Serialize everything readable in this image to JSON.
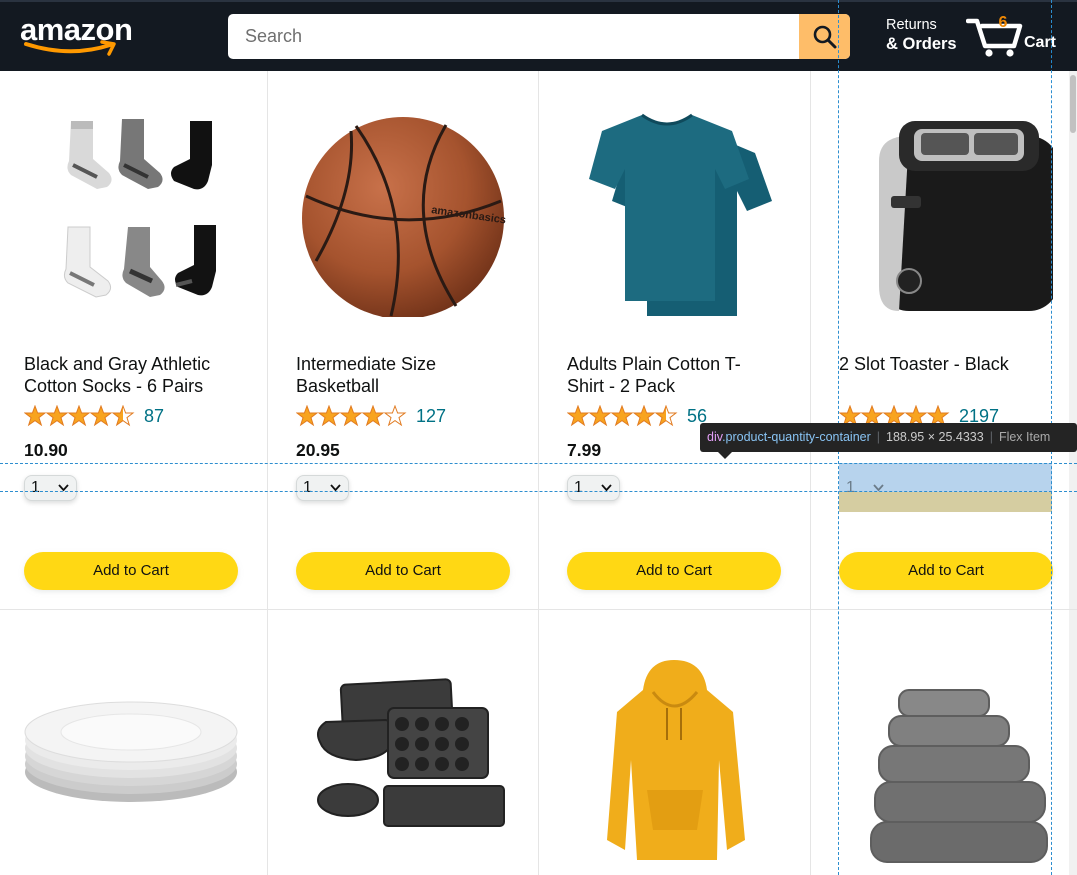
{
  "header": {
    "logo_text": "amazon",
    "search": {
      "placeholder": "Search"
    },
    "returns_line1": "Returns",
    "returns_line2": "& Orders",
    "cart_count": "6",
    "cart_label": "Cart"
  },
  "products": [
    {
      "name": "Black and Gray Athletic Cotton Socks - 6 Pairs",
      "rating_stars": 4.5,
      "rating_count": "87",
      "price": "10.90",
      "quantity": "1",
      "add_label": "Add to Cart",
      "image": "socks"
    },
    {
      "name": "Intermediate Size Basketball",
      "rating_stars": 4.0,
      "rating_count": "127",
      "price": "20.95",
      "quantity": "1",
      "add_label": "Add to Cart",
      "image": "basketball"
    },
    {
      "name": "Adults Plain Cotton T-Shirt - 2 Pack",
      "rating_stars": 4.5,
      "rating_count": "56",
      "price": "7.99",
      "quantity": "1",
      "add_label": "Add to Cart",
      "image": "tshirt"
    },
    {
      "name": "2 Slot Toaster - Black",
      "rating_stars": 5.0,
      "rating_count": "2197",
      "price": "",
      "quantity": "1",
      "add_label": "Add to Cart",
      "image": "toaster"
    },
    {
      "image": "plates"
    },
    {
      "image": "bakeware"
    },
    {
      "image": "hoodie"
    },
    {
      "image": "towels"
    }
  ],
  "devtools_tooltip": {
    "tag": "div",
    "class_name": ".product-quantity-container",
    "dimensions": "188.95 × 25.4333",
    "kind": "Flex Item"
  },
  "colors": {
    "header_bg": "#131921",
    "search_button": "#febd69",
    "cart_count": "#f08804",
    "add_to_cart": "#ffd814",
    "rating_count": "#007185",
    "star": "#f8a41f"
  }
}
